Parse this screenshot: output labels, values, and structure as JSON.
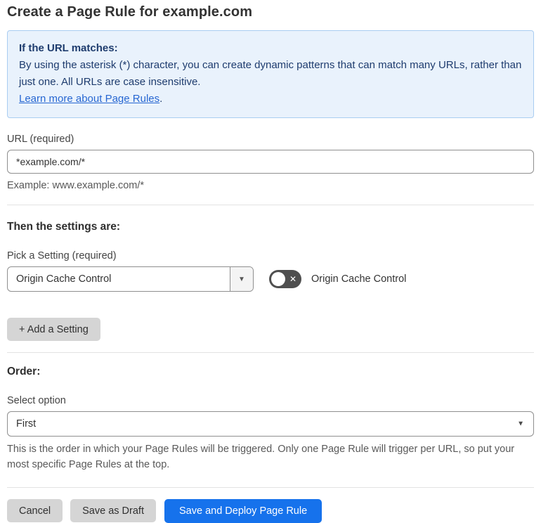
{
  "page": {
    "title": "Create a Page Rule for example.com"
  },
  "info_box": {
    "heading": "If the URL matches:",
    "body": "By using the asterisk (*) character, you can create dynamic patterns that can match many URLs, rather than just one. All URLs are case insensitive.",
    "link_label": "Learn more about Page Rules",
    "link_suffix": "."
  },
  "url_field": {
    "label": "URL (required)",
    "value": "*example.com/*",
    "helper": "Example: www.example.com/*"
  },
  "settings_section": {
    "heading": "Then the settings are:",
    "picker_label": "Pick a Setting (required)",
    "picker_value": "Origin Cache Control",
    "toggle_state": "off",
    "toggle_label": "Origin Cache Control",
    "add_setting_label": "+ Add a Setting"
  },
  "order_section": {
    "heading": "Order:",
    "select_label": "Select option",
    "select_value": "First",
    "helper": "This is the order in which your Page Rules will be triggered. Only one Page Rule will trigger per URL, so put your most specific Page Rules at the top."
  },
  "footer": {
    "cancel_label": "Cancel",
    "save_draft_label": "Save as Draft",
    "save_deploy_label": "Save and Deploy Page Rule"
  },
  "icons": {
    "dropdown_arrow": "▼",
    "toggle_off": "✕"
  },
  "colors": {
    "accent_blue": "#1672ec",
    "info_bg": "#e9f2fc",
    "info_border": "#a9cdf1",
    "info_text": "#1e3c6e",
    "link_blue": "#2767d2",
    "toggle_off_bg": "#4f4f4f",
    "gray_button_bg": "#d5d5d5"
  }
}
